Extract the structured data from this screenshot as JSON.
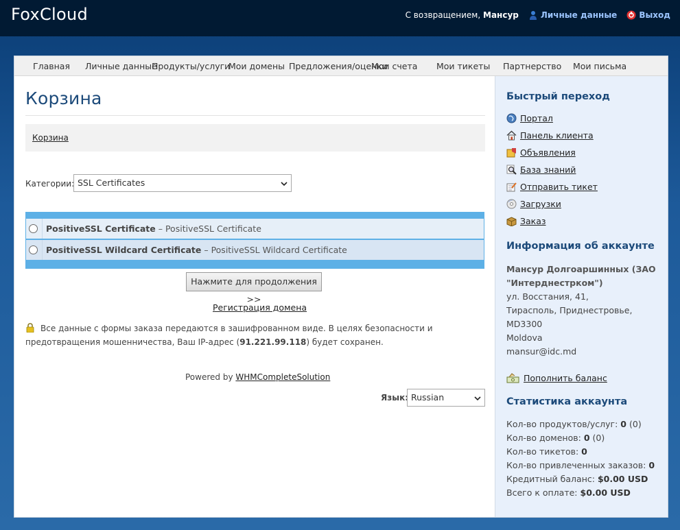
{
  "header": {
    "logo": "FoxCloud",
    "welcome_prefix": "С возвращением,",
    "user_name": "Мансур",
    "personal_link": "Личные данные",
    "logout_link": "Выход"
  },
  "nav": {
    "items": [
      "Главная",
      "Личные данные",
      "Продукты/услуги",
      "Мои домены",
      "Предложения/оценки",
      "Мои счета",
      "Мои тикеты",
      "Партнерство",
      "Мои письма"
    ]
  },
  "main": {
    "title": "Корзина",
    "breadcrumb": "Корзина",
    "category_label": "Категории:",
    "category_selected": "SSL Certificates",
    "products": [
      {
        "name": "PositiveSSL Certificate",
        "desc": " – PositiveSSL Certificate"
      },
      {
        "name": "PositiveSSL Wildcard Certificate",
        "desc": " – PositiveSSL Wildcard Certificate"
      }
    ],
    "continue_button": "Нажмите для продолжения >>",
    "register_domain_link": "Регистрация домена",
    "notice_text": "Все данные с формы заказа передаются в зашифрованном виде. В целях безопасности и предотвращения мошенничества, Ваш IP-адрес (",
    "ip_address": "91.221.99.118",
    "notice_suffix": ") будет сохранен.",
    "powered_prefix": "Powered by ",
    "powered_link": "WHMCompleteSolution",
    "language_label": "Язык:",
    "language_selected": "Russian"
  },
  "sidebar": {
    "quick_title": "Быстрый переход",
    "quick_links": [
      {
        "label": "Портал",
        "icon": "globe-icon"
      },
      {
        "label": "Панель клиента",
        "icon": "home-icon"
      },
      {
        "label": "Объявления",
        "icon": "announcement-icon"
      },
      {
        "label": "База знаний",
        "icon": "magnifier-icon"
      },
      {
        "label": "Отправить тикет",
        "icon": "ticket-icon"
      },
      {
        "label": "Загрузки",
        "icon": "disc-icon"
      },
      {
        "label": "Заказ",
        "icon": "box-icon"
      }
    ],
    "account_title": "Информация об аккаунте",
    "account_name": "Мансур Долгоаршинных (ЗАО \"Интерднестрком\")",
    "address_1": "ул. Восстания, 41,",
    "address_2": "Тирасполь, Приднестровье,",
    "postcode": "MD3300",
    "country": "Moldova",
    "email": "mansur@idc.md",
    "add_funds": "Пополнить баланс",
    "stats_title": "Статистика аккаунта",
    "stats": {
      "products_label": "Кол-во продуктов/услуг:",
      "products_value": "0",
      "products_extra": "(0)",
      "domains_label": "Кол-во доменов:",
      "domains_value": "0",
      "domains_extra": "(0)",
      "tickets_label": "Кол-во тикетов:",
      "tickets_value": "0",
      "referrals_label": "Кол-во привлеченных заказов:",
      "referrals_value": "0",
      "credit_label": "Кредитный баланс:",
      "credit_value": "$0.00 USD",
      "due_label": "Всего к оплате:",
      "due_value": "$0.00 USD"
    }
  },
  "colors": {
    "header_bg": "#011a33",
    "accent": "#1c4a7a",
    "table_border": "#5db0e6",
    "row_1": "#e6eff8",
    "row_2": "#d8e5f3",
    "sidebar_bg": "#e8f0fb"
  }
}
